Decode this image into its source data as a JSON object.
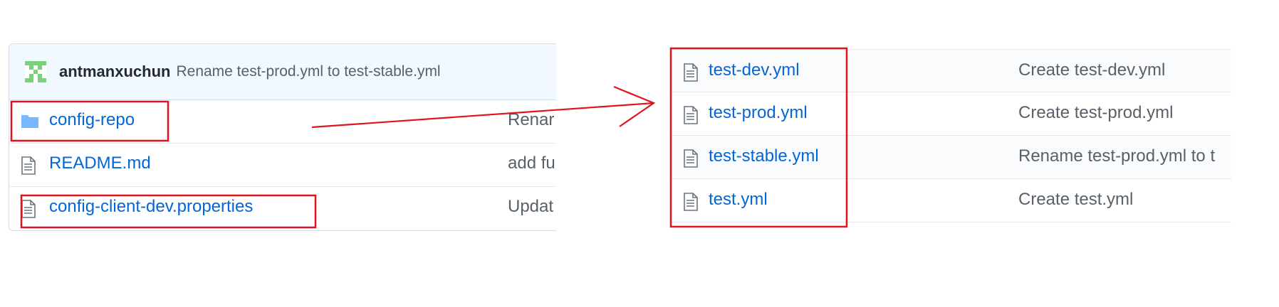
{
  "commit": {
    "author": "antmanxuchun",
    "message": "Rename test-prod.yml to test-stable.yml"
  },
  "left_files": [
    {
      "name": "config-repo",
      "icon": "folder-icon",
      "message": "Renar"
    },
    {
      "name": "README.md",
      "icon": "file-icon",
      "message": "add fu"
    },
    {
      "name": "config-client-dev.properties",
      "icon": "file-icon",
      "message": "Updat"
    }
  ],
  "right_files": [
    {
      "name": "test-dev.yml",
      "icon": "file-icon",
      "message": "Create test-dev.yml"
    },
    {
      "name": "test-prod.yml",
      "icon": "file-icon",
      "message": "Create test-prod.yml"
    },
    {
      "name": "test-stable.yml",
      "icon": "file-icon",
      "message": "Rename test-prod.yml to t"
    },
    {
      "name": "test.yml",
      "icon": "file-icon",
      "message": "Create test.yml"
    }
  ],
  "colors": {
    "link": "#0366d6",
    "annotation": "#e0141e",
    "folder": "#79b8ff"
  }
}
